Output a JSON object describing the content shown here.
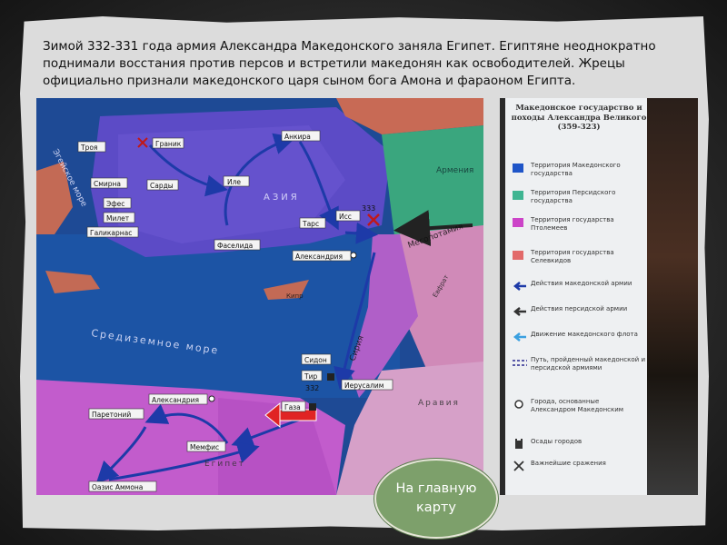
{
  "caption": "Зимой 332-331 года армия Александра Македонского заняла Египет. Египтяне неоднократно поднимали восстания против персов и встретили македонян как освободителей. Жрецы официально признали македонского царя сыном бога Амона и фараоном Египта.",
  "map": {
    "cities": [
      "Троя",
      "Граник",
      "Анкира",
      "Смирна",
      "Сарды",
      "Эфес",
      "Милет",
      "Галикарнас",
      "Иле",
      "Тарс",
      "Исс",
      "Фаселида",
      "Александрия",
      "Сидон",
      "Тир",
      "Иерусалим",
      "Газа",
      "Александрия",
      "Паретоний",
      "Мемфис",
      "Оазис Аммона"
    ],
    "region_labels": [
      "Эгейское море",
      "Средиземное море",
      "АЗИЯ",
      "Армения",
      "Месопотамия",
      "Сирия",
      "Кипр",
      "Аравия",
      "Египет",
      "Евфрат"
    ],
    "battle_years": [
      "333",
      "332"
    ]
  },
  "legend": {
    "title": "Македонское государство и походы Александра Великого (359-323)",
    "items": [
      {
        "label": "Территория Македонского государства",
        "color": "#1f55c8"
      },
      {
        "label": "Территория Персидского государства",
        "color": "#3fb592"
      },
      {
        "label": "Территория государства Птолемеев",
        "color": "#cc44c8"
      },
      {
        "label": "Территория государства Селевкидов",
        "color": "#e26a6a"
      },
      {
        "label": "Действия македонской армии",
        "icon": "blue-arrow-icon"
      },
      {
        "label": "Действия персидской армии",
        "icon": "dark-arrow-icon"
      },
      {
        "label": "Движение македонского флота",
        "icon": "fleet-arrow-icon"
      },
      {
        "label": "Путь, пройденный македонской и персидской армиями",
        "icon": "dashed-path-icon"
      },
      {
        "label": "Города, основанные Александром Македонским",
        "icon": "city-dot-icon"
      },
      {
        "label": "Осады городов",
        "icon": "siege-icon"
      },
      {
        "label": "Важнейшие сражения",
        "icon": "crossed-swords-icon"
      }
    ]
  },
  "home_button": {
    "label": "На главную карту"
  }
}
